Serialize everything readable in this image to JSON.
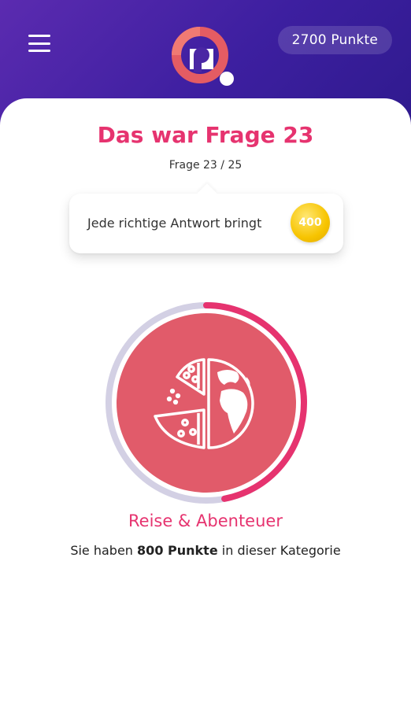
{
  "header": {
    "points_label": "2700 Punkte",
    "menu_icon": "hamburger-menu-icon",
    "logo_icon": "quiz-logo-icon",
    "colors": {
      "gradient_start": "#5b2bb0",
      "gradient_end": "#2f1a8e"
    }
  },
  "result": {
    "title": "Das war Frage 23",
    "progress": "Frage 23 / 25"
  },
  "reward": {
    "text": "Jede richtige Antwort bringt",
    "coin_value": "400",
    "coin_color": "#f7c400"
  },
  "category": {
    "name": "Reise & Abenteuer",
    "icon": "pizza-globe-icon",
    "progress_fraction": 0.47,
    "colors": {
      "fill": "#e15b6a",
      "track": "#d3d0e4",
      "progress": "#e6336f"
    },
    "points_prefix": "Sie haben",
    "points_value": "800 Punkte",
    "points_suffix": "in dieser Kategorie"
  }
}
